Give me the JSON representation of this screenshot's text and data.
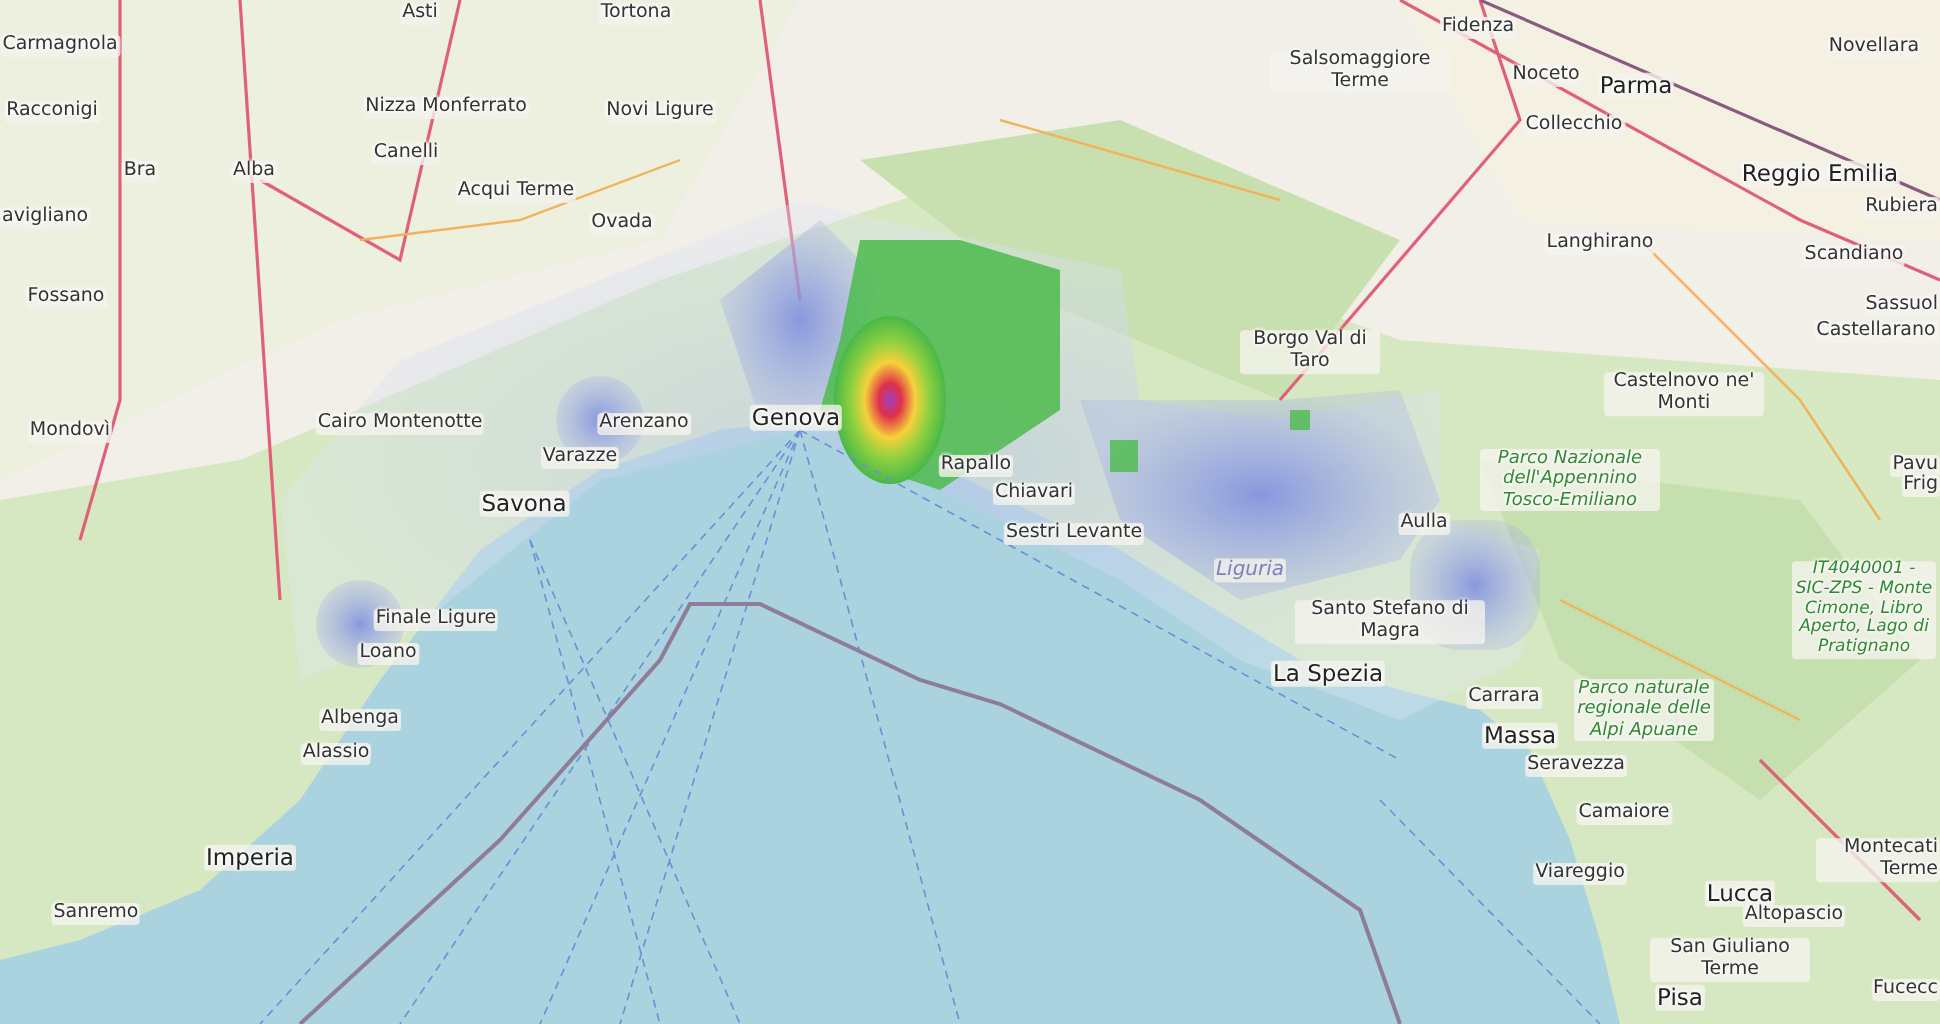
{
  "map": {
    "labels": [
      {
        "text": "Asti",
        "kind": "town"
      },
      {
        "text": "Tortona",
        "kind": "town"
      },
      {
        "text": "Carmagnola",
        "kind": "town"
      },
      {
        "text": "Racconigi",
        "kind": "town"
      },
      {
        "text": "Nizza Monferrato",
        "kind": "town"
      },
      {
        "text": "Novi Ligure",
        "kind": "town"
      },
      {
        "text": "Bra",
        "kind": "town"
      },
      {
        "text": "Alba",
        "kind": "town"
      },
      {
        "text": "Canelli",
        "kind": "town"
      },
      {
        "text": "Acqui Terme",
        "kind": "town"
      },
      {
        "text": "avigliano",
        "kind": "town"
      },
      {
        "text": "Ovada",
        "kind": "town"
      },
      {
        "text": "Fossano",
        "kind": "town"
      },
      {
        "text": "Mondovì",
        "kind": "town"
      },
      {
        "text": "Cairo Montenotte",
        "kind": "town"
      },
      {
        "text": "Arenzano",
        "kind": "town"
      },
      {
        "text": "Genova",
        "kind": "city"
      },
      {
        "text": "Varazze",
        "kind": "town"
      },
      {
        "text": "Savona",
        "kind": "city"
      },
      {
        "text": "Rapallo",
        "kind": "town"
      },
      {
        "text": "Chiavari",
        "kind": "town"
      },
      {
        "text": "Sestri Levante",
        "kind": "town"
      },
      {
        "text": "Finale Ligure",
        "kind": "town"
      },
      {
        "text": "Loano",
        "kind": "town"
      },
      {
        "text": "Albenga",
        "kind": "town"
      },
      {
        "text": "Alassio",
        "kind": "town"
      },
      {
        "text": "Imperia",
        "kind": "city"
      },
      {
        "text": "Sanremo",
        "kind": "town"
      },
      {
        "text": "Fidenza",
        "kind": "town"
      },
      {
        "text": "Salsomaggiore Terme",
        "kind": "town"
      },
      {
        "text": "Noceto",
        "kind": "town"
      },
      {
        "text": "Parma",
        "kind": "city"
      },
      {
        "text": "Novellara",
        "kind": "town"
      },
      {
        "text": "Collecchio",
        "kind": "town"
      },
      {
        "text": "Reggio Emilia",
        "kind": "city"
      },
      {
        "text": "Rubiera",
        "kind": "town"
      },
      {
        "text": "Langhirano",
        "kind": "town"
      },
      {
        "text": "Scandiano",
        "kind": "town"
      },
      {
        "text": "Sassuol",
        "kind": "town"
      },
      {
        "text": "Castellarano",
        "kind": "town"
      },
      {
        "text": "Borgo Val di Taro",
        "kind": "town"
      },
      {
        "text": "Castelnovo ne' Monti",
        "kind": "town"
      },
      {
        "text": "Parco Nazionale dell'Appennino Tosco-Emiliano",
        "kind": "park"
      },
      {
        "text": "Pavu",
        "kind": "town"
      },
      {
        "text": "Frig",
        "kind": "town"
      },
      {
        "text": "Aulla",
        "kind": "town"
      },
      {
        "text": "Liguria",
        "kind": "region"
      },
      {
        "text": "IT4040001 - SIC-ZPS - Monte Cimone, Libro Aperto, Lago di Pratignano",
        "kind": "park"
      },
      {
        "text": "Santo Stefano di Magra",
        "kind": "town"
      },
      {
        "text": "La Spezia",
        "kind": "city"
      },
      {
        "text": "Carrara",
        "kind": "town"
      },
      {
        "text": "Massa",
        "kind": "city"
      },
      {
        "text": "Parco naturale regionale delle Alpi Apuane",
        "kind": "park"
      },
      {
        "text": "Seravezza",
        "kind": "town"
      },
      {
        "text": "Camaiore",
        "kind": "town"
      },
      {
        "text": "Viareggio",
        "kind": "town"
      },
      {
        "text": "Montecati Terme",
        "kind": "town"
      },
      {
        "text": "Lucca",
        "kind": "city"
      },
      {
        "text": "Altopascio",
        "kind": "town"
      },
      {
        "text": "San Giuliano Terme",
        "kind": "town"
      },
      {
        "text": "Pisa",
        "kind": "city"
      },
      {
        "text": "Fucecc",
        "kind": "town"
      }
    ]
  }
}
